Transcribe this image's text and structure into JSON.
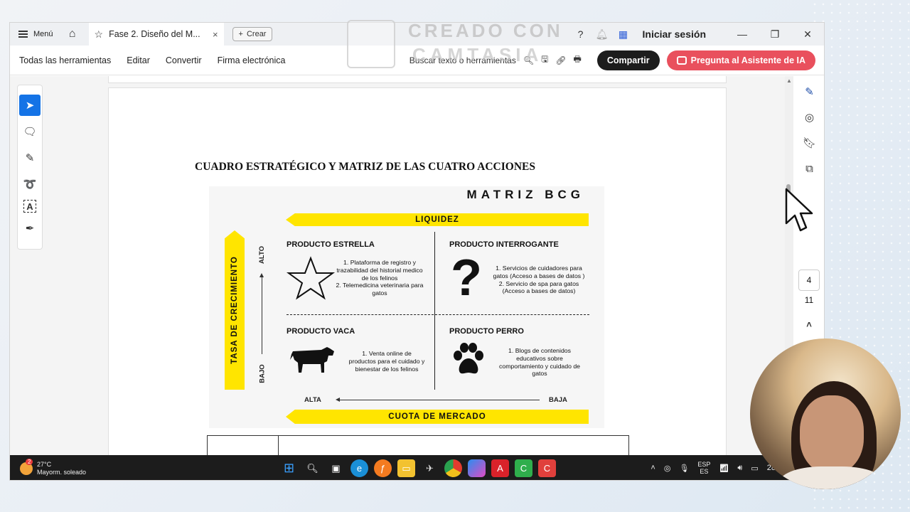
{
  "titlebar": {
    "menu_label": "Menú",
    "tab_title": "Fase 2. Diseño del M...",
    "tab_close": "×",
    "create_label": "Crear",
    "signin_label": "Iniciar sesión"
  },
  "toolbar": {
    "all_tools": "Todas las herramientas",
    "edit": "Editar",
    "convert": "Convertir",
    "esign": "Firma electrónica",
    "search_text": "Buscar texto o herramientas",
    "share": "Compartir",
    "ai_assistant": "Pregunta al Asistente de IA"
  },
  "watermark": {
    "line1": "CREADO CON",
    "line2": "CAMTASIA"
  },
  "document": {
    "heading": "CUADRO ESTRATÉGICO Y MATRIZ DE LAS CUATRO ACCIONES",
    "matrix": {
      "title": "MATRIZ BCG",
      "top_band": "LIQUIDEZ",
      "bottom_band": "CUOTA DE MERCADO",
      "left_band": "TASA DE CRECIMIENTO",
      "alto": "ALTO",
      "bajo": "BAJO",
      "alta": "ALTA",
      "baja": "BAJA",
      "q1": {
        "title": "PRODUCTO ESTRELLA",
        "items": [
          "1. Plataforma de registro y trazabilidad del historial medico de los felinos",
          "2. Telemedicina veterinaria para gatos"
        ]
      },
      "q2": {
        "title": "PRODUCTO INTERROGANTE",
        "items": [
          "1. Servicios de cuidadores para gatos (Acceso a bases de datos )",
          "2. Servicio de spa para gatos (Acceso a bases de datos)"
        ]
      },
      "q3": {
        "title": "PRODUCTO VACA",
        "items": [
          "1. Venta online de productos para el cuidado y bienestar de los felinos"
        ]
      },
      "q4": {
        "title": "PRODUCTO PERRO",
        "items": [
          "1. Blogs de contenidos educativos sobre comportamiento y cuidado de gatos"
        ]
      }
    }
  },
  "pager": {
    "current": "4",
    "total": "11"
  },
  "taskbar": {
    "badge": "2",
    "temp": "27°C",
    "condition": "Mayorm. soleado",
    "lang1": "ESP",
    "lang2": "ES",
    "time_partial": "28"
  }
}
